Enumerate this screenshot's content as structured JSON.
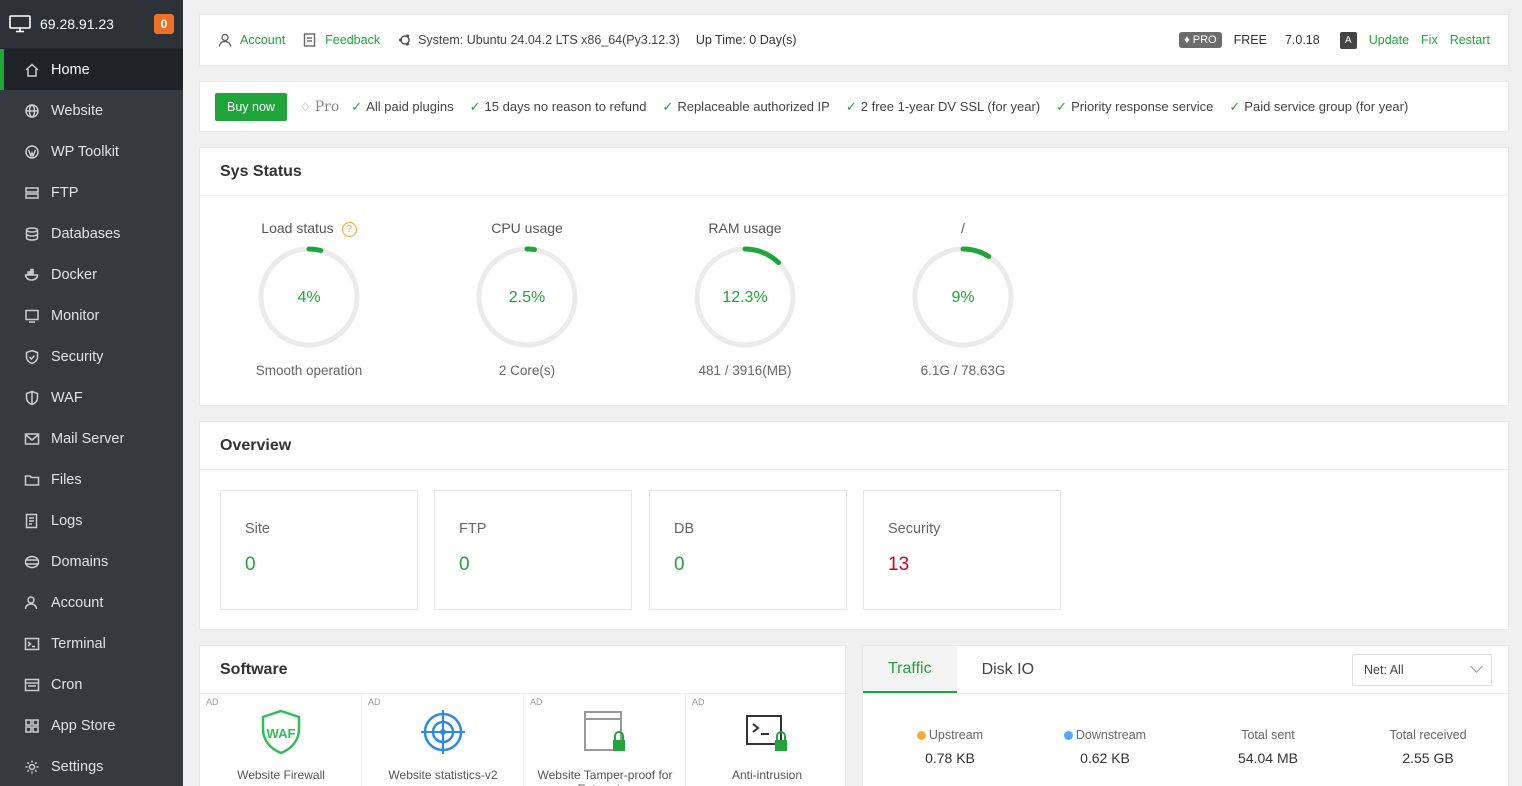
{
  "sidebar": {
    "ip": "69.28.91.23",
    "badge": "0",
    "items": [
      {
        "label": "Home",
        "icon": "home-icon"
      },
      {
        "label": "Website",
        "icon": "globe-icon"
      },
      {
        "label": "WP Toolkit",
        "icon": "wordpress-icon"
      },
      {
        "label": "FTP",
        "icon": "ftp-icon"
      },
      {
        "label": "Databases",
        "icon": "database-icon"
      },
      {
        "label": "Docker",
        "icon": "docker-icon"
      },
      {
        "label": "Monitor",
        "icon": "monitor-icon"
      },
      {
        "label": "Security",
        "icon": "shield-check-icon"
      },
      {
        "label": "WAF",
        "icon": "shield-icon"
      },
      {
        "label": "Mail Server",
        "icon": "mail-icon"
      },
      {
        "label": "Files",
        "icon": "folder-icon"
      },
      {
        "label": "Logs",
        "icon": "logs-icon"
      },
      {
        "label": "Domains",
        "icon": "domain-icon"
      },
      {
        "label": "Account",
        "icon": "user-icon"
      },
      {
        "label": "Terminal",
        "icon": "terminal-icon"
      },
      {
        "label": "Cron",
        "icon": "cron-icon"
      },
      {
        "label": "App Store",
        "icon": "grid-icon"
      },
      {
        "label": "Settings",
        "icon": "gear-icon"
      }
    ]
  },
  "topbar": {
    "account": "Account",
    "feedback": "Feedback",
    "system": "System: Ubuntu 24.04.2 LTS x86_64(Py3.12.3)",
    "uptime": "Up Time: 0 Day(s)",
    "pro_badge": "PRO",
    "plan": "FREE",
    "version": "7.0.18",
    "lang": "A",
    "update": "Update",
    "fix": "Fix",
    "restart": "Restart"
  },
  "promo": {
    "buy": "Buy now",
    "pro": "Pro",
    "features": [
      "All paid plugins",
      "15 days no reason to refund",
      "Replaceable authorized IP",
      "2 free 1-year DV SSL (for year)",
      "Priority response service",
      "Paid service group (for year)"
    ]
  },
  "sys_status": {
    "title": "Sys Status",
    "gauges": [
      {
        "label": "Load status",
        "value": "4%",
        "sub": "Smooth operation",
        "pct": 4
      },
      {
        "label": "CPU usage",
        "value": "2.5%",
        "sub": "2 Core(s)",
        "pct": 2.5
      },
      {
        "label": "RAM usage",
        "value": "12.3%",
        "sub": "481 / 3916(MB)",
        "pct": 12.3
      },
      {
        "label": "/",
        "value": "9%",
        "sub": "6.1G / 78.63G",
        "pct": 9
      }
    ],
    "help": "?"
  },
  "overview": {
    "title": "Overview",
    "boxes": [
      {
        "label": "Site",
        "value": "0"
      },
      {
        "label": "FTP",
        "value": "0"
      },
      {
        "label": "DB",
        "value": "0"
      },
      {
        "label": "Security",
        "value": "13"
      }
    ],
    "security_color": "#d0021b"
  },
  "software": {
    "title": "Software",
    "ad": "AD",
    "items": [
      {
        "name": "Website Firewall",
        "icon": "waf-icon"
      },
      {
        "name": "Website statistics-v2",
        "icon": "target-icon"
      },
      {
        "name": "Website Tamper-proof for Enterprise",
        "icon": "tamper-proof-icon"
      },
      {
        "name": "Anti-intrusion",
        "icon": "terminal-lock-icon"
      }
    ]
  },
  "traffic": {
    "tabs": [
      "Traffic",
      "Disk IO"
    ],
    "net_select": "Net: All",
    "stats": [
      {
        "label": "Upstream",
        "value": "0.78 KB",
        "dot": "#f5b031"
      },
      {
        "label": "Downstream",
        "value": "0.62 KB",
        "dot": "#52a9ff"
      },
      {
        "label": "Total sent",
        "value": "54.04 MB"
      },
      {
        "label": "Total received",
        "value": "2.55 GB"
      }
    ]
  },
  "colors": {
    "accent": "#20a53a",
    "sidebar": "#353a41",
    "badge": "#f0702b"
  }
}
